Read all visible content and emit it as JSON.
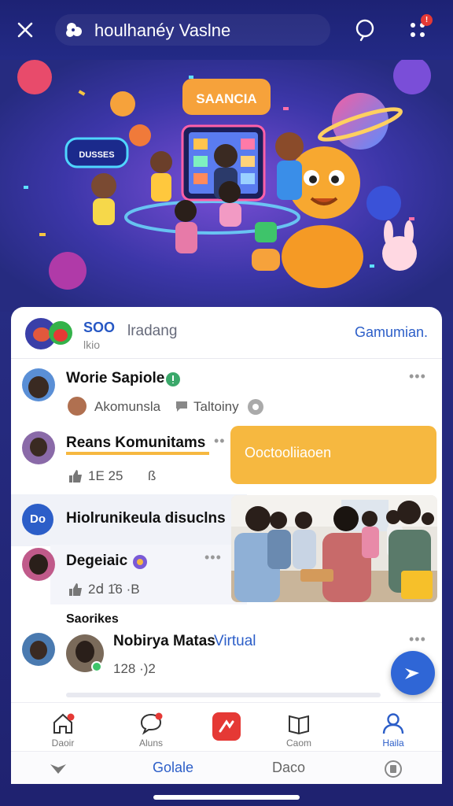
{
  "topbar": {
    "title": "houlhanéy Vaslne",
    "notif_badge": "!"
  },
  "hero": {
    "sign_text": "SAANCIA",
    "bubble_text": "DUSSES"
  },
  "panel_header": {
    "logo_text": "SOO",
    "trading": "lradang",
    "sub": "lkio",
    "right_link": "Gamumian."
  },
  "posts": [
    {
      "name": "Worie Sapiole",
      "meta_a": "Akomunsla",
      "meta_b": "Taltoiny"
    },
    {
      "name": "Reans Komunitams",
      "likes": "1E 25",
      "extra": "ß"
    },
    {
      "name": "Hiolrunikeula disuclns",
      "badge": "Do"
    },
    {
      "name": "Degeiaic",
      "stats": "2ⅾ 1̂6  ·B"
    },
    {
      "name": "Nobirya Matas",
      "name_accent": "Virtual",
      "stats": "128  ·)2"
    }
  ],
  "section_label": "Saorikes",
  "banner": {
    "text": "Ooctooliiaoen"
  },
  "tabs": [
    {
      "label": "Daoir"
    },
    {
      "label": "Aluns"
    },
    {
      "label": ""
    },
    {
      "label": "Caom"
    },
    {
      "label": "Haila"
    }
  ],
  "bottom_nav": {
    "center": "Golale",
    "right": "Daco"
  },
  "colors": {
    "accent": "#2c5ec8",
    "banner": "#f6b840",
    "app_bg": "#262b80"
  }
}
